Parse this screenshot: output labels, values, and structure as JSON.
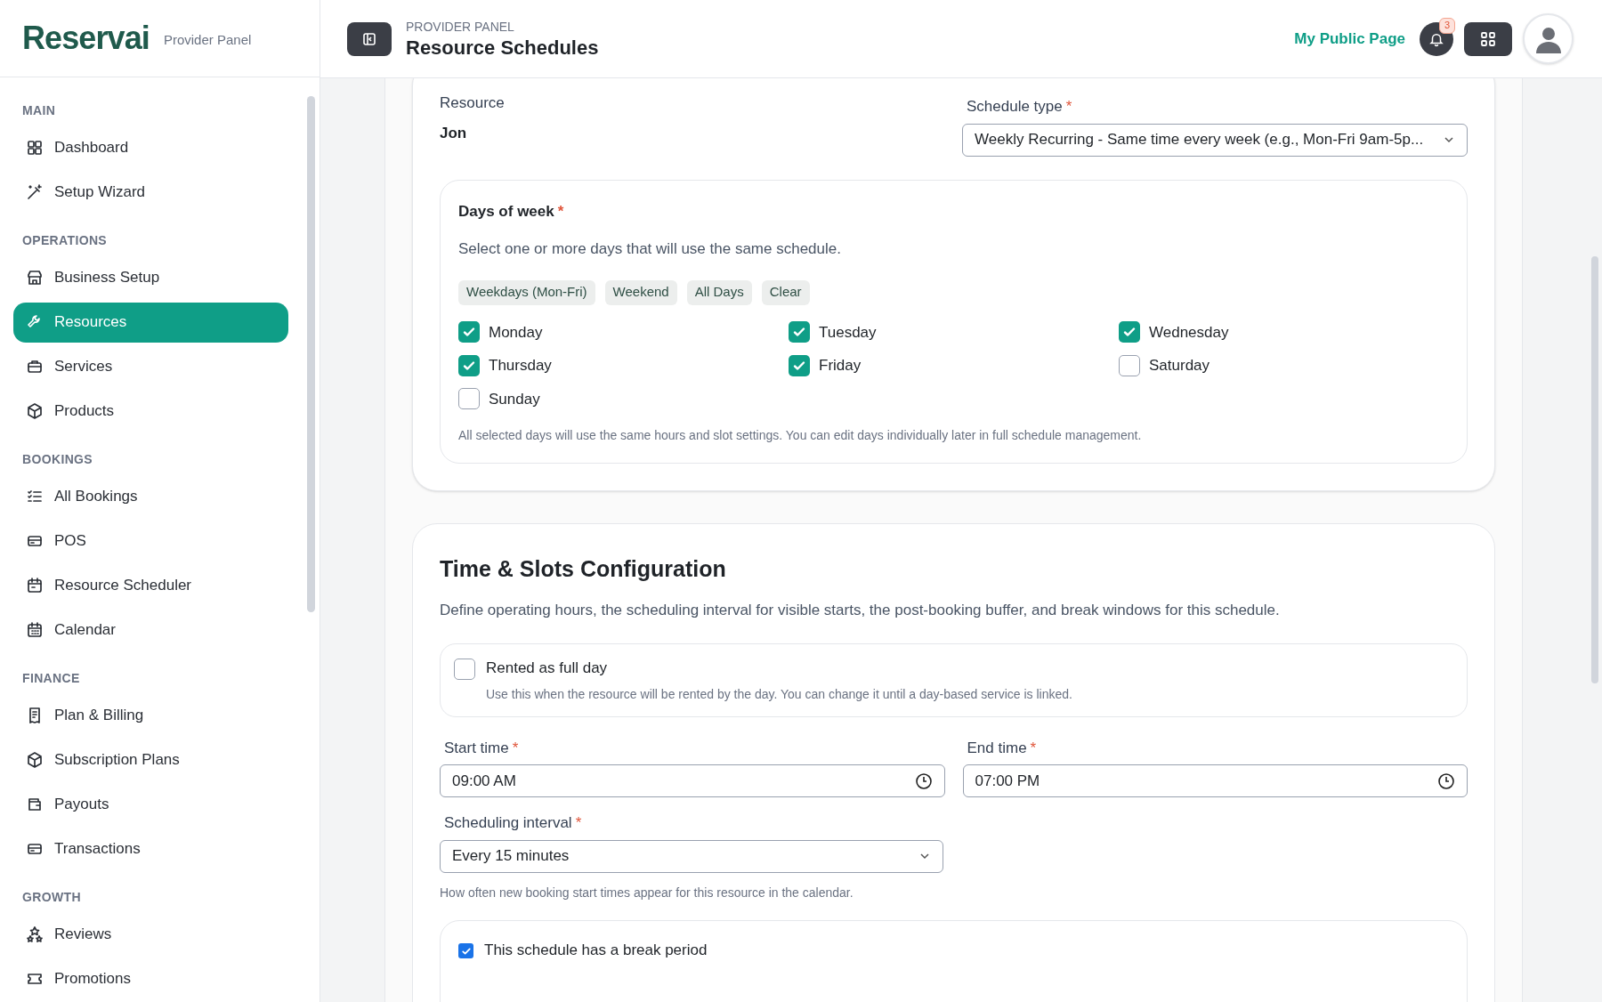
{
  "brand": {
    "logo": "Reservai",
    "subtitle": "Provider Panel"
  },
  "sidebar": {
    "sections": [
      {
        "title": "MAIN",
        "items": [
          {
            "label": "Dashboard",
            "selected": false
          },
          {
            "label": "Setup Wizard",
            "selected": false
          }
        ]
      },
      {
        "title": "OPERATIONS",
        "items": [
          {
            "label": "Business Setup",
            "selected": false
          },
          {
            "label": "Resources",
            "selected": true
          },
          {
            "label": "Services",
            "selected": false
          },
          {
            "label": "Products",
            "selected": false
          }
        ]
      },
      {
        "title": "BOOKINGS",
        "items": [
          {
            "label": "All Bookings",
            "selected": false
          },
          {
            "label": "POS",
            "selected": false
          },
          {
            "label": "Resource Scheduler",
            "selected": false
          },
          {
            "label": "Calendar",
            "selected": false
          }
        ]
      },
      {
        "title": "FINANCE",
        "items": [
          {
            "label": "Plan & Billing",
            "selected": false
          },
          {
            "label": "Subscription Plans",
            "selected": false
          },
          {
            "label": "Payouts",
            "selected": false
          },
          {
            "label": "Transactions",
            "selected": false
          }
        ]
      },
      {
        "title": "GROWTH",
        "items": [
          {
            "label": "Reviews",
            "selected": false
          },
          {
            "label": "Promotions",
            "selected": false
          }
        ]
      }
    ]
  },
  "header": {
    "eyebrow": "PROVIDER PANEL",
    "title": "Resource Schedules",
    "public_link": "My Public Page",
    "notification_count": "3"
  },
  "schedule_card": {
    "resource_label": "Resource",
    "resource_value": "Jon",
    "schedule_type": {
      "label": "Schedule type",
      "required_mark": "*",
      "value": "Weekly Recurring - Same time every week (e.g., Mon-Fri 9am-5p..."
    },
    "days": {
      "label": "Days of week",
      "required_mark": "*",
      "description": "Select one or more days that will use the same schedule.",
      "presets": [
        "Weekdays (Mon-Fri)",
        "Weekend",
        "All Days",
        "Clear"
      ],
      "options": [
        {
          "label": "Monday",
          "checked": true
        },
        {
          "label": "Tuesday",
          "checked": true
        },
        {
          "label": "Wednesday",
          "checked": true
        },
        {
          "label": "Thursday",
          "checked": true
        },
        {
          "label": "Friday",
          "checked": true
        },
        {
          "label": "Saturday",
          "checked": false
        },
        {
          "label": "Sunday",
          "checked": false
        }
      ],
      "note": "All selected days will use the same hours and slot settings. You can edit days individually later in full schedule management."
    }
  },
  "time_card": {
    "title": "Time & Slots Configuration",
    "description": "Define operating hours, the scheduling interval for visible starts, the post-booking buffer, and break windows for this schedule.",
    "full_day": {
      "label": "Rented as full day",
      "checked": false,
      "hint": "Use this when the resource will be rented by the day. You can change it until a day-based service is linked."
    },
    "start_time": {
      "label": "Start time",
      "required_mark": "*",
      "value": "09:00 AM"
    },
    "end_time": {
      "label": "End time",
      "required_mark": "*",
      "value": "07:00 PM"
    },
    "interval": {
      "label": "Scheduling interval",
      "required_mark": "*",
      "value": "Every 15 minutes",
      "hint": "How often new booking start times appear for this resource in the calendar."
    },
    "break": {
      "label": "This schedule has a break period",
      "checked": true
    }
  }
}
